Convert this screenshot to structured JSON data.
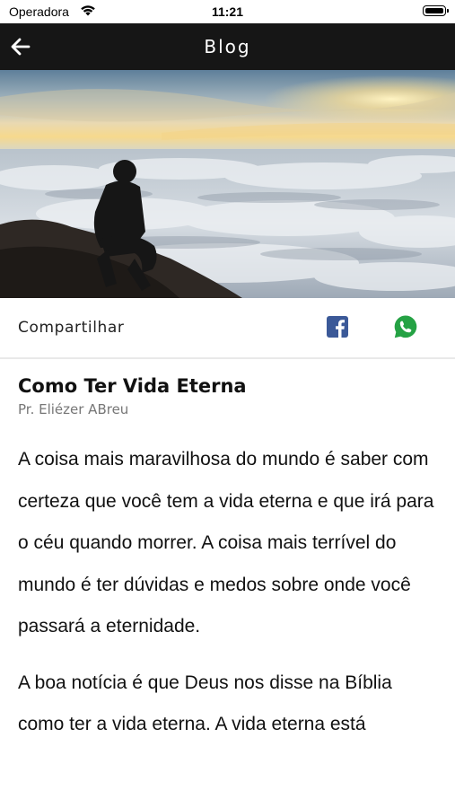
{
  "status_bar": {
    "carrier": "Operadora",
    "time": "11:21"
  },
  "navbar": {
    "title": "Blog",
    "back_icon": "arrow-left-icon"
  },
  "share": {
    "label": "Compartilhar",
    "facebook_icon": "facebook-icon",
    "whatsapp_icon": "whatsapp-icon",
    "facebook_color": "#3b5998",
    "whatsapp_color": "#25a244"
  },
  "article": {
    "title": "Como Ter Vida Eterna",
    "author": "Pr. Eliézer ABreu",
    "paragraph1": "A coisa mais maravilhosa do mundo é saber com certeza que você tem a vida eterna e que irá para o céu quando morrer. A coisa mais terrível do mundo é ter dúvidas e medos sobre onde você passará a eternidade.",
    "paragraph2": "A boa notícia é que Deus nos disse na Bíblia como ter a vida eterna. A vida eterna está"
  }
}
